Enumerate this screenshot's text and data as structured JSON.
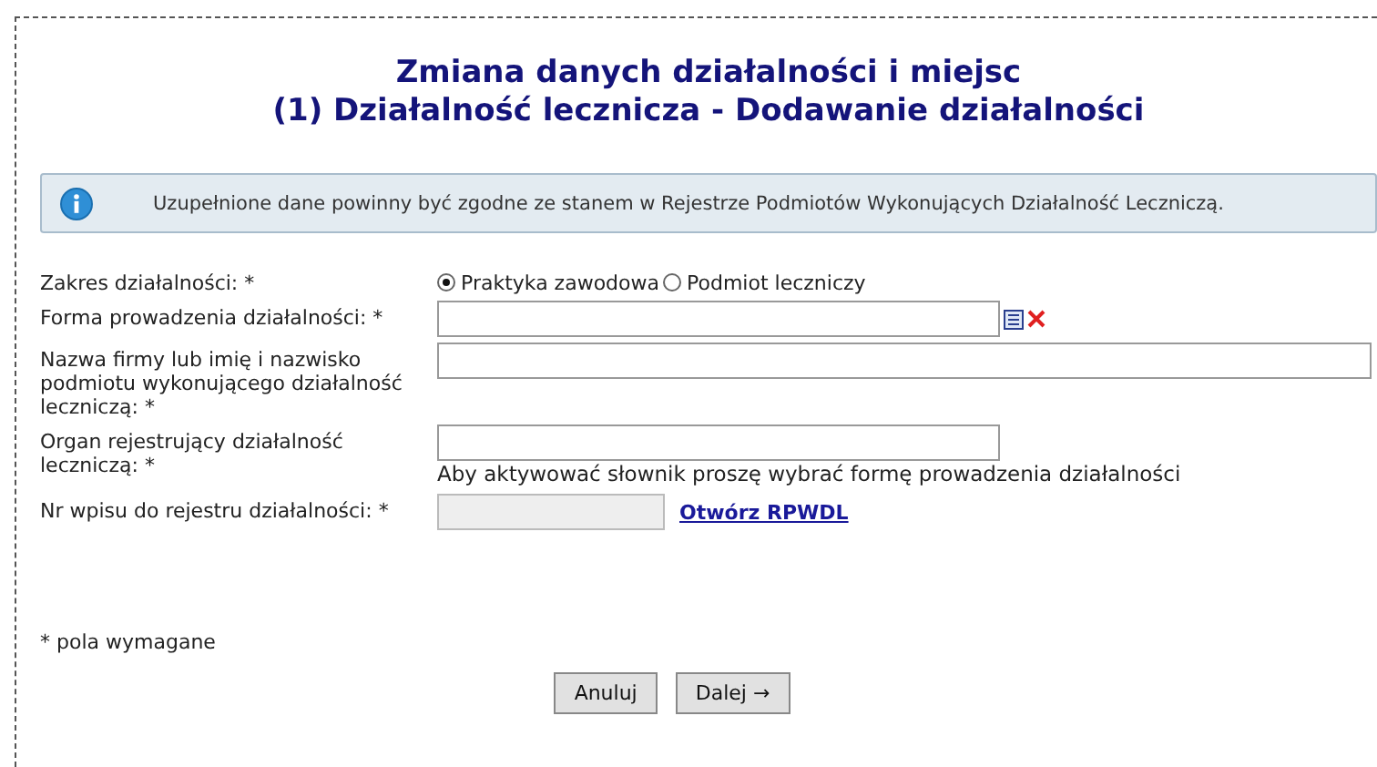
{
  "title": [
    "Zmiana danych działalności i miejsc",
    "(1) Działalność lecznicza - Dodawanie działalności"
  ],
  "info": "Uzupełnione dane powinny być zgodne ze stanem w Rejestrze Podmiotów Wykonujących Działalność Leczniczą.",
  "fields": [
    {
      "kind": "radio",
      "label": "Zakres działalności: *",
      "options": [
        {
          "label": "Praktyka zawodowa",
          "selected": true
        },
        {
          "label": "Podmiot leczniczy",
          "selected": false
        }
      ]
    },
    {
      "kind": "dictionary",
      "label": "Forma prowadzenia działalności: *",
      "disabled": false
    },
    {
      "kind": "wide",
      "label": "Nazwa firmy lub imię i nazwisko podmiotu wykonującego działalność leczniczą: *",
      "disabled": false
    },
    {
      "kind": "hinted",
      "label": "Organ rejestrujący działalność leczniczą: *",
      "hint": "Aby aktywować słownik proszę wybrać formę prowadzenia działalności",
      "disabled": false
    },
    {
      "kind": "linked",
      "label": "Nr wpisu do rejestru działalności: *",
      "link": "Otwórz RPWDL",
      "disabled": true
    }
  ],
  "required_note": "* pola wymagane",
  "buttons": [
    "Anuluj",
    "Dalej →"
  ]
}
